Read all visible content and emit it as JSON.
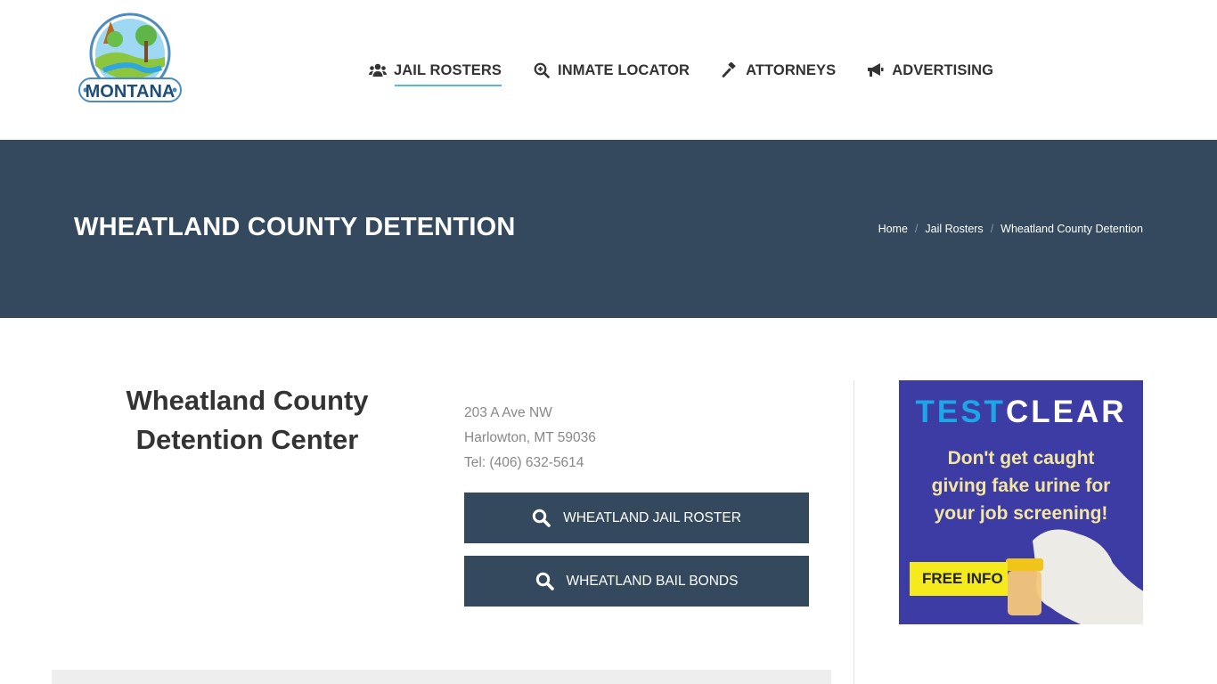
{
  "header": {
    "logo_text": "MONTANA",
    "nav": [
      {
        "label": "JAIL ROSTERS",
        "icon": "users-icon",
        "active": true
      },
      {
        "label": "INMATE LOCATOR",
        "icon": "search-plus-icon",
        "active": false
      },
      {
        "label": "ATTORNEYS",
        "icon": "gavel-icon",
        "active": false
      },
      {
        "label": "ADVERTISING",
        "icon": "bullhorn-icon",
        "active": false
      }
    ]
  },
  "titlebar": {
    "title": "WHEATLAND COUNTY DETENTION",
    "breadcrumb": [
      "Home",
      "Jail Rosters",
      "Wheatland County Detention"
    ],
    "separator": "/"
  },
  "facility": {
    "name_line1": "Wheatland County",
    "name_line2": "Detention Center",
    "address_line1": "203 A Ave NW",
    "address_line2": "Harlowton, MT 59036",
    "phone": "Tel: (406) 632-5614",
    "buttons": [
      {
        "label": "WHEATLAND JAIL ROSTER",
        "icon": "search-icon"
      },
      {
        "label": "WHEATLAND BAIL BONDS",
        "icon": "search-icon"
      }
    ]
  },
  "ad": {
    "brand_part1": "TEST",
    "brand_part2": "CLEAR",
    "text_line1": "Don't get caught",
    "text_line2": "giving fake urine for",
    "text_line3": "your job screening!",
    "cta": "FREE INFO"
  },
  "colors": {
    "primary": "#34495e",
    "nav_underline": "#4ec2c8",
    "ad_bg": "#3c3ca4",
    "ad_cta": "#f4ea1c"
  }
}
